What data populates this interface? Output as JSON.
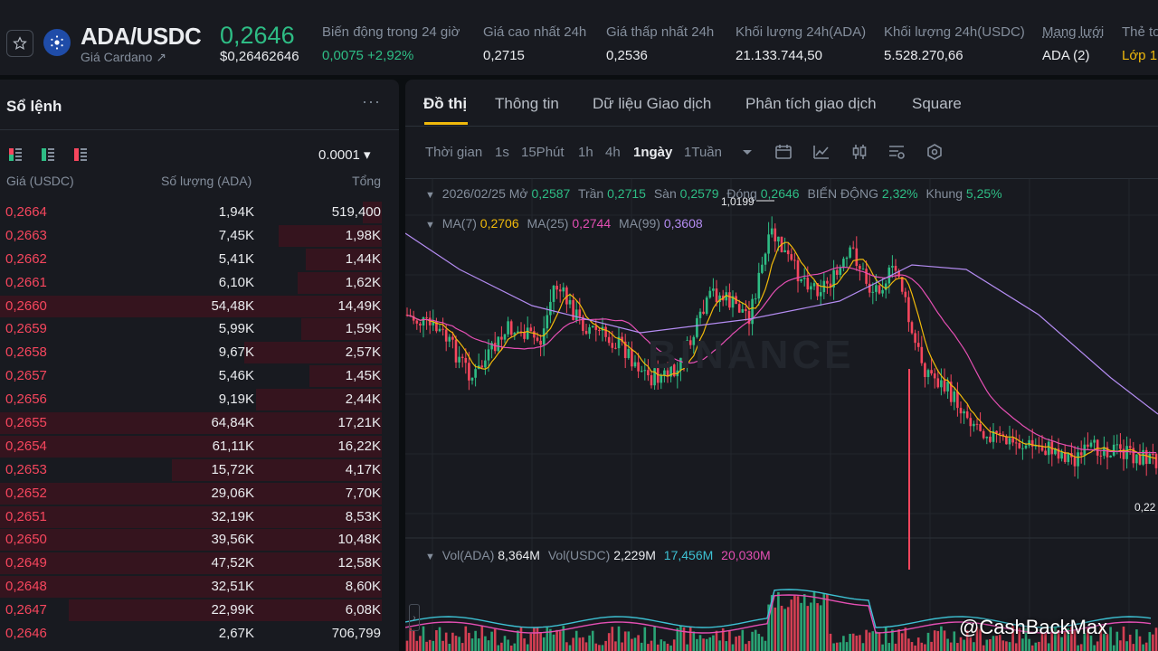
{
  "ticker": {
    "pair": "ADA/USDC",
    "subtitle": "Giá Cardano ↗",
    "last_price": "0,2646",
    "last_price_usd": "$0,26462646",
    "stats": [
      {
        "label": "Biến động trong 24 giờ",
        "value": "0,0075 +2,92%"
      },
      {
        "label": "Giá cao nhất 24h",
        "value": "0,2715"
      },
      {
        "label": "Giá thấp nhất 24h",
        "value": "0,2536"
      },
      {
        "label": "Khối lượng 24h(ADA)",
        "value": "21.133.744,50"
      },
      {
        "label": "Khối lượng 24h(USDC)",
        "value": "5.528.270,66"
      },
      {
        "label": "Mạng lưới",
        "value": "ADA (2)"
      },
      {
        "label": "Thẻ to",
        "value": "Lớp 1"
      }
    ]
  },
  "orderbook": {
    "title": "Sổ lệnh",
    "more": "···",
    "tick_size": "0.0001 ▾",
    "headers": {
      "price": "Giá (USDC)",
      "qty": "Số lượng (ADA)",
      "total": "Tổng"
    },
    "asks": [
      {
        "price": "0,2664",
        "qty": "1,94K",
        "total": "519,400",
        "depth": 0.05
      },
      {
        "price": "0,2663",
        "qty": "7,45K",
        "total": "1,98K",
        "depth": 0.27
      },
      {
        "price": "0,2662",
        "qty": "5,41K",
        "total": "1,44K",
        "depth": 0.2
      },
      {
        "price": "0,2661",
        "qty": "6,10K",
        "total": "1,62K",
        "depth": 0.22
      },
      {
        "price": "0,2660",
        "qty": "54,48K",
        "total": "14,49K",
        "depth": 1.0
      },
      {
        "price": "0,2659",
        "qty": "5,99K",
        "total": "1,59K",
        "depth": 0.21
      },
      {
        "price": "0,2658",
        "qty": "9,67K",
        "total": "2,57K",
        "depth": 0.36
      },
      {
        "price": "0,2657",
        "qty": "5,46K",
        "total": "1,45K",
        "depth": 0.19
      },
      {
        "price": "0,2656",
        "qty": "9,19K",
        "total": "2,44K",
        "depth": 0.33
      },
      {
        "price": "0,2655",
        "qty": "64,84K",
        "total": "17,21K",
        "depth": 1.0
      },
      {
        "price": "0,2654",
        "qty": "61,11K",
        "total": "16,22K",
        "depth": 1.0
      },
      {
        "price": "0,2653",
        "qty": "15,72K",
        "total": "4,17K",
        "depth": 0.55
      },
      {
        "price": "0,2652",
        "qty": "29,06K",
        "total": "7,70K",
        "depth": 1.0
      },
      {
        "price": "0,2651",
        "qty": "32,19K",
        "total": "8,53K",
        "depth": 1.0
      },
      {
        "price": "0,2650",
        "qty": "39,56K",
        "total": "10,48K",
        "depth": 1.0
      },
      {
        "price": "0,2649",
        "qty": "47,52K",
        "total": "12,58K",
        "depth": 1.0
      },
      {
        "price": "0,2648",
        "qty": "32,51K",
        "total": "8,60K",
        "depth": 1.0
      },
      {
        "price": "0,2647",
        "qty": "22,99K",
        "total": "6,08K",
        "depth": 0.82
      },
      {
        "price": "0,2646",
        "qty": "2,67K",
        "total": "706,799",
        "depth": 0.0
      }
    ]
  },
  "chart": {
    "tabs": [
      "Đồ thị",
      "Thông tin",
      "Dữ liệu Giao dịch",
      "Phân tích giao dịch",
      "Square"
    ],
    "intervals": {
      "time": "Thời gian",
      "s1": "1s",
      "m15": "15Phút",
      "h1": "1h",
      "h4": "4h",
      "d1": "1ngày",
      "w1": "1Tuần"
    },
    "ohlc": {
      "date": "2026/02/25",
      "open_label": "Mở",
      "open": "0,2587",
      "high_label": "Trần",
      "high": "0,2715",
      "low_label": "Sàn",
      "low": "0,2579",
      "close_label": "Đóng",
      "close": "0,2646",
      "change_label": "BIẾN ĐỘNG",
      "change": "2,32%",
      "range_label": "Khung",
      "range": "5,25%"
    },
    "ma": {
      "ma7_label": "MA(7)",
      "ma7": "0,2706",
      "ma25_label": "MA(25)",
      "ma25": "0,2744",
      "ma99_label": "MA(99)",
      "ma99": "0,3608"
    },
    "volume": {
      "vol_ada_label": "Vol(ADA)",
      "vol_ada": "8,364M",
      "vol_usdc_label": "Vol(USDC)",
      "vol_usdc": "2,229M",
      "v1": "17,456M",
      "v2": "20,030M"
    },
    "high_marker": "1,0199",
    "low_marker": "0,22",
    "watermark": "BINANCE",
    "credit": "@CashBackMax",
    "colors": {
      "up": "#2ebd85",
      "down": "#f6465d",
      "ma7": "#f0b90b",
      "ma25": "#e44fb3",
      "ma99": "#b48cf2"
    }
  }
}
